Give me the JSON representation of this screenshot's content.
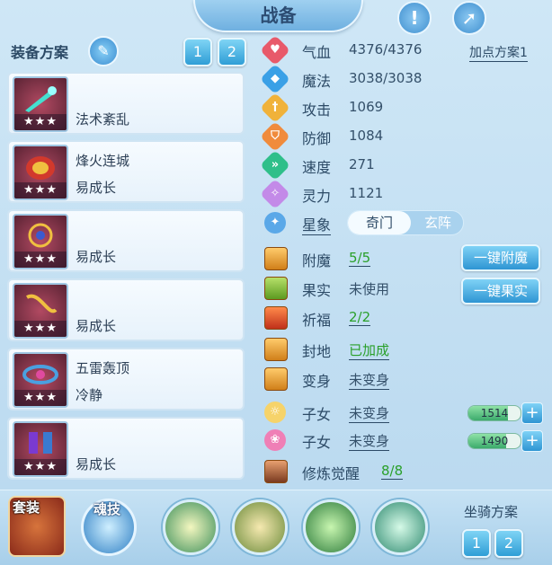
{
  "title": "战备",
  "top_icons": [
    "exclamation-icon",
    "share-icon"
  ],
  "equip_plan": {
    "label": "装备方案",
    "tabs": [
      "1",
      "2"
    ]
  },
  "equipment": [
    {
      "name": "",
      "sub": "法术紊乱",
      "stars": "★★★",
      "color": "#b04a62"
    },
    {
      "name": "烽火连城",
      "sub": "易成长",
      "stars": "★★★",
      "color": "#8d2f3c"
    },
    {
      "name": "",
      "sub": "易成长",
      "stars": "★★★",
      "color": "#b04a62"
    },
    {
      "name": "",
      "sub": "易成长",
      "stars": "★★★",
      "color": "#b04a62"
    },
    {
      "name": "五雷轰顶",
      "sub": "冷静",
      "stars": "★★★",
      "color": "#b04a62"
    },
    {
      "name": "",
      "sub": "易成长",
      "stars": "★★★",
      "color": "#b04a62"
    }
  ],
  "stats": [
    {
      "name": "气血",
      "value": "4376/4376",
      "icon": "heart-icon",
      "color": "#e85a6a"
    },
    {
      "name": "魔法",
      "value": "3038/3038",
      "icon": "mana-diamond-icon",
      "color": "#3aa0e6"
    },
    {
      "name": "攻击",
      "value": "1069",
      "icon": "sword-icon",
      "color": "#f0b23a"
    },
    {
      "name": "防御",
      "value": "1084",
      "icon": "shield-icon",
      "color": "#f08b3c"
    },
    {
      "name": "速度",
      "value": "271",
      "icon": "speed-icon",
      "color": "#2fbf8a"
    },
    {
      "name": "灵力",
      "value": "1121",
      "icon": "spirit-icon",
      "color": "#c38ae8"
    }
  ],
  "add_point_plan": "加点方案1",
  "xingxiang": {
    "label": "星象",
    "option_a": "奇门",
    "option_b": "玄阵"
  },
  "status_rows": [
    {
      "name": "附魔",
      "value": "5/5",
      "green": true,
      "underline": true
    },
    {
      "name": "果实",
      "value": "未使用",
      "green": false,
      "underline": false
    },
    {
      "name": "祈福",
      "value": "2/2",
      "green": true,
      "underline": true
    },
    {
      "name": "封地",
      "value": "已加成",
      "green": true,
      "underline": true
    },
    {
      "name": "变身",
      "value": "未变身",
      "green": false,
      "underline": true
    },
    {
      "name": "子女",
      "value": "未变身",
      "green": false,
      "underline": true
    },
    {
      "name": "子女",
      "value": "未变身",
      "green": false,
      "underline": true
    },
    {
      "name": "修炼觉醒",
      "value": "8/8",
      "green": true,
      "underline": true
    }
  ],
  "buttons": {
    "enchant_all": "一键附魔",
    "fruit_all": "一键果实"
  },
  "child_bars": [
    {
      "value": "1514",
      "fill": 0.75
    },
    {
      "value": "1490",
      "fill": 0.72
    }
  ],
  "bottom": {
    "set_label": "套装",
    "soul_label": "魂技",
    "mount_plan_label": "坐骑方案",
    "mount_tabs": [
      "1",
      "2"
    ]
  }
}
